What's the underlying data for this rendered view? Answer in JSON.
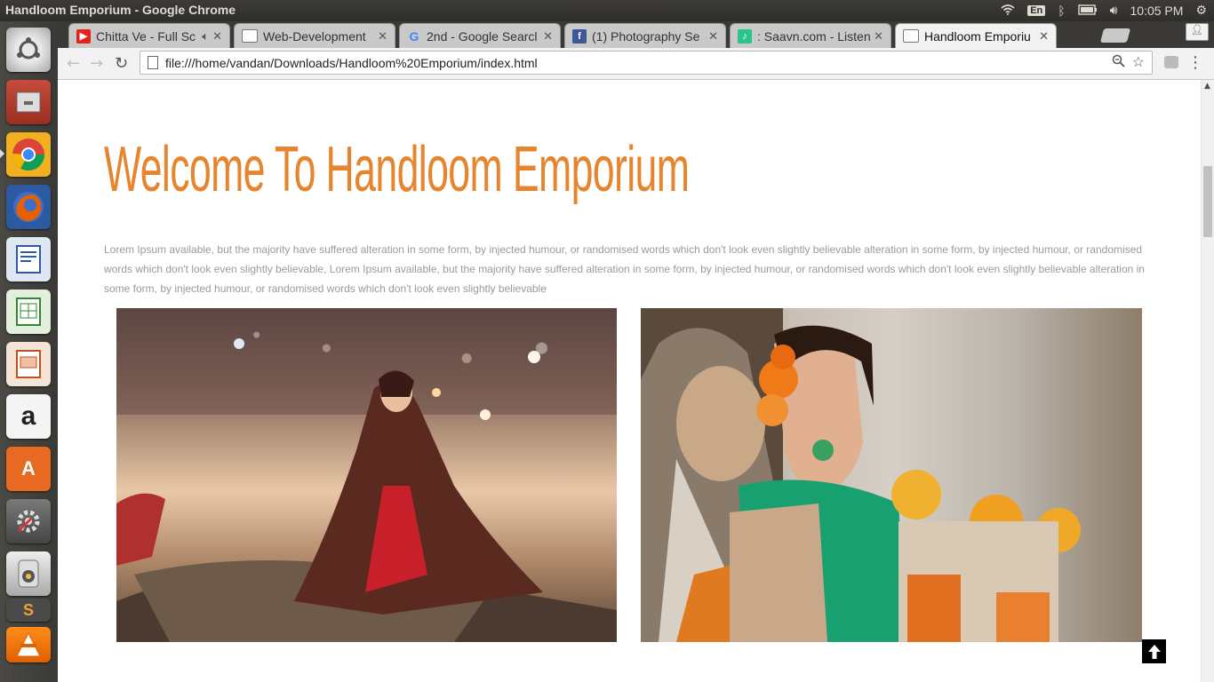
{
  "window": {
    "title": "Handloom Emporium - Google Chrome"
  },
  "system_tray": {
    "keyboard": "En",
    "time": "10:05 PM"
  },
  "launcher": {
    "items": [
      {
        "name": "ubuntu-dash-icon"
      },
      {
        "name": "files-icon"
      },
      {
        "name": "chrome-icon"
      },
      {
        "name": "firefox-icon"
      },
      {
        "name": "writer-icon"
      },
      {
        "name": "calc-icon"
      },
      {
        "name": "impress-icon"
      },
      {
        "name": "amazon-icon",
        "label": "a"
      },
      {
        "name": "software-center-icon",
        "label": "A"
      },
      {
        "name": "system-settings-icon"
      },
      {
        "name": "rhythmbox-icon"
      },
      {
        "name": "sublime-icon",
        "label": "S"
      },
      {
        "name": "vlc-icon"
      }
    ]
  },
  "tabs": [
    {
      "title": "Chitta Ve - Full Sc",
      "icon": "youtube-icon",
      "active": false
    },
    {
      "title": "Web-Development",
      "icon": "page-icon",
      "active": false
    },
    {
      "title": "2nd - Google Searcl",
      "icon": "google-icon",
      "active": false
    },
    {
      "title": "(1) Photography Se",
      "icon": "facebook-icon",
      "active": false
    },
    {
      "title": ": Saavn.com - Listen",
      "icon": "saavn-icon",
      "active": false
    },
    {
      "title": "Handloom Emporiu",
      "icon": "page-icon",
      "active": true
    }
  ],
  "toolbar": {
    "url": "file:///home/vandan/Downloads/Handloom%20Emporium/index.html"
  },
  "page": {
    "heading": "Welcome To Handloom Emporium",
    "paragraph": "Lorem Ipsum available, but the majority have suffered alteration in some form, by injected humour, or randomised words which don't look even slightly believable alteration in some form, by injected humour, or randomised words which don't look even slightly believable, Lorem Ipsum available, but the majority have suffered alteration in some form, by injected humour, or randomised words which don't look even slightly believable alteration in some form, by injected humour, or randomised words which don't look even slightly believable",
    "heading_color": "#e7852e"
  }
}
